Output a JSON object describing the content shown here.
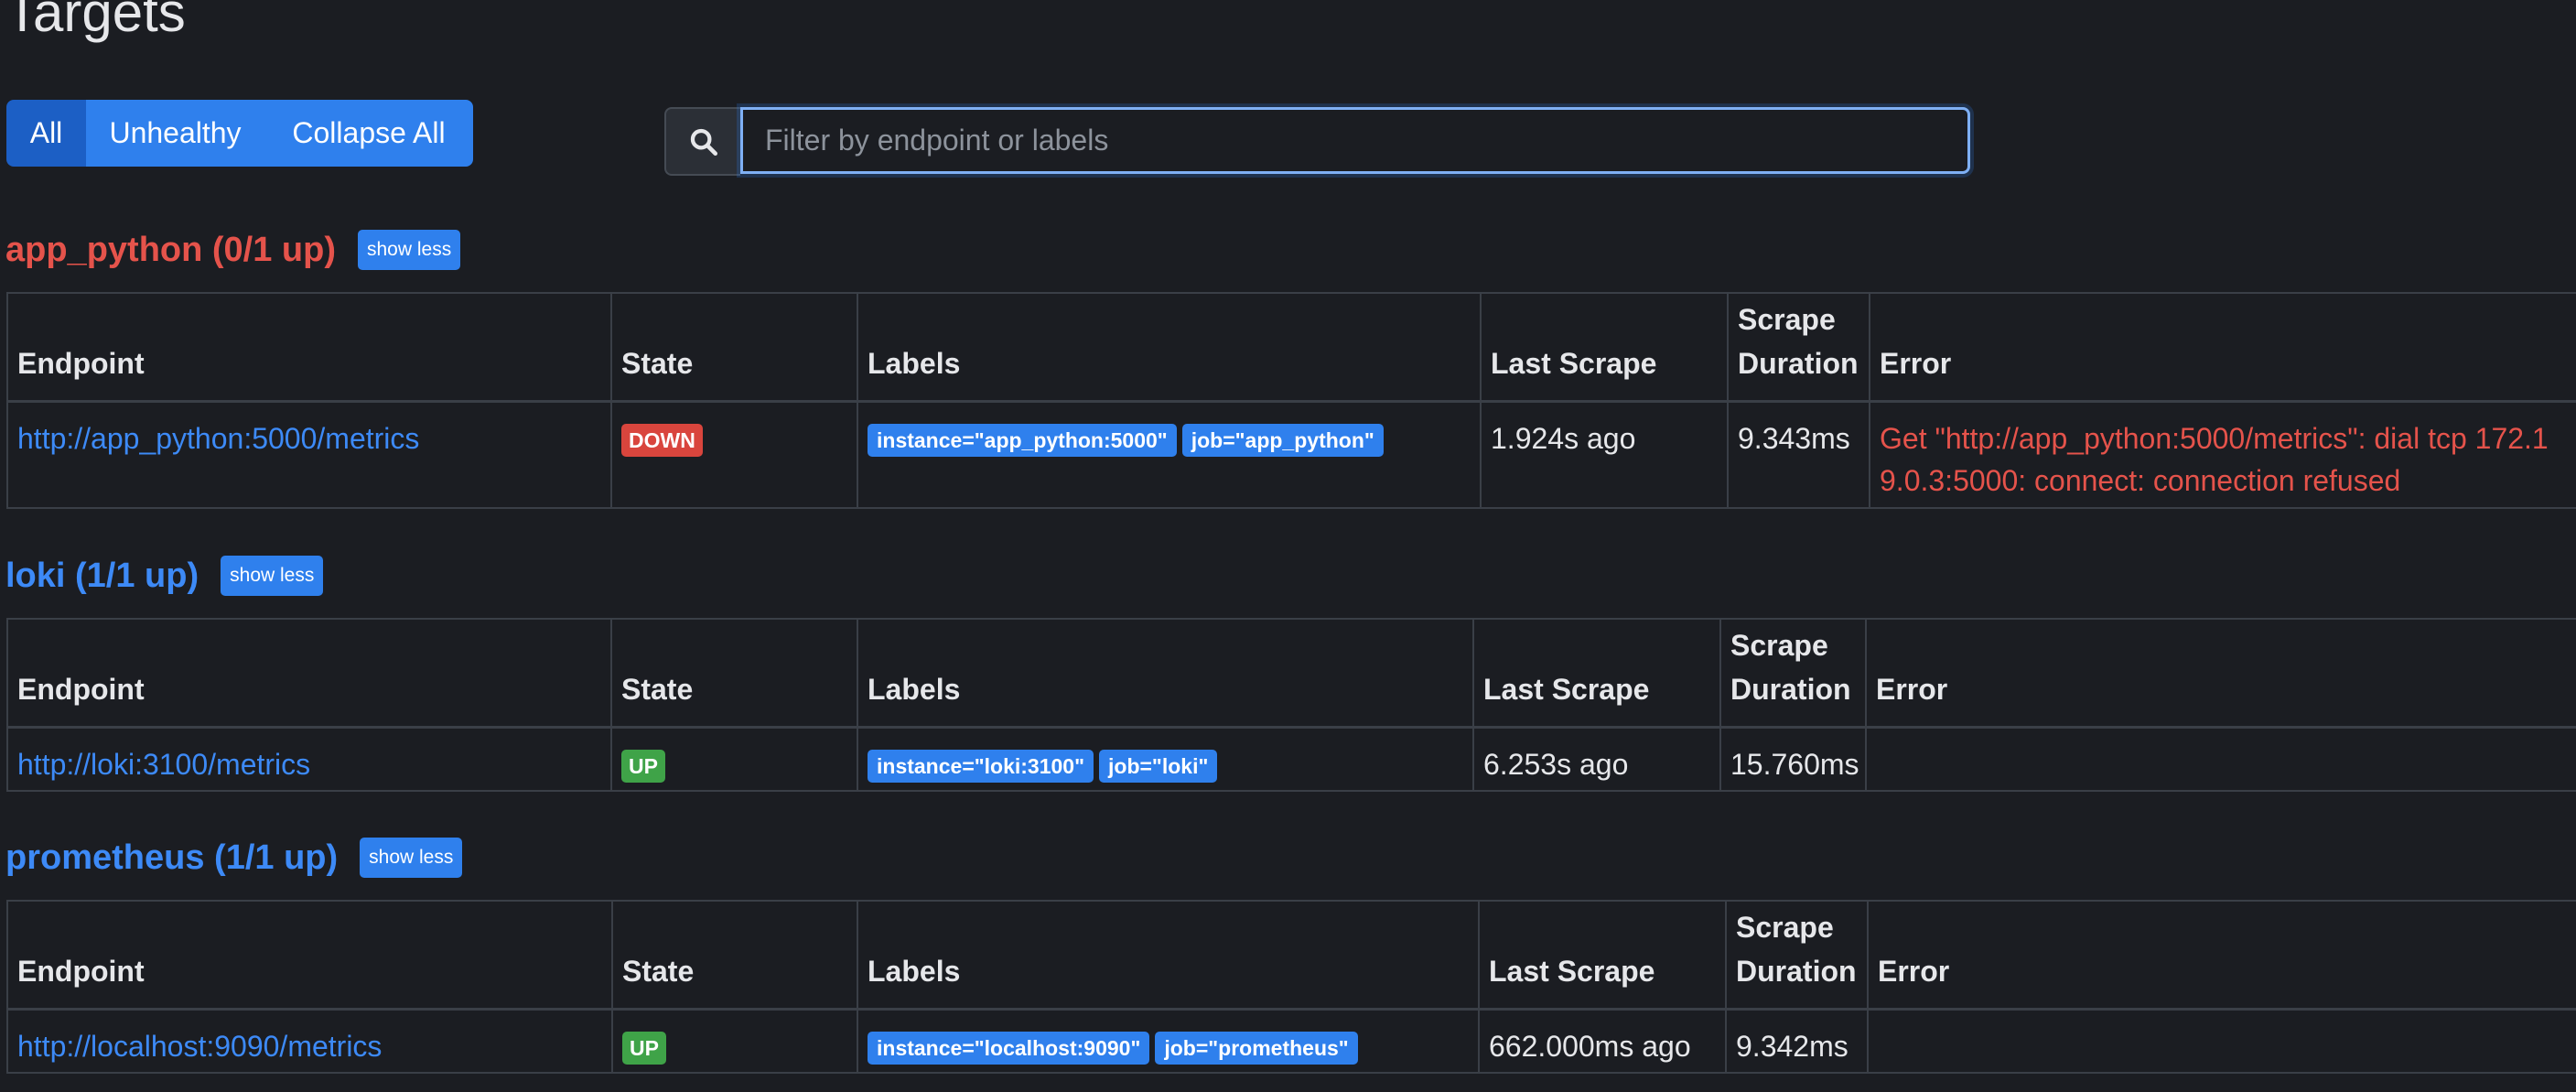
{
  "page": {
    "title": "Targets"
  },
  "filters": {
    "all": "All",
    "unhealthy": "Unhealthy",
    "collapse_all": "Collapse All"
  },
  "search": {
    "placeholder": "Filter by endpoint or labels",
    "icon": "search-icon"
  },
  "columns": {
    "endpoint": "Endpoint",
    "state": "State",
    "labels": "Labels",
    "last_scrape": "Last Scrape",
    "scrape_duration_1": "Scrape",
    "scrape_duration_2": "Duration",
    "error": "Error"
  },
  "jobs": [
    {
      "title": "app_python (0/1 up)",
      "toggle": "show less",
      "title_color": "#e5534b",
      "rows": [
        {
          "endpoint": "http://app_python:5000/metrics",
          "state": "DOWN",
          "labels": [
            "instance=\"app_python:5000\"",
            "job=\"app_python\""
          ],
          "last_scrape": "1.924s ago",
          "scrape_duration": "9.343ms",
          "error_line1": "Get \"http://app_python:5000/metrics\": dial tcp 172.1",
          "error_line2": "9.0.3:5000: connect: connection refused"
        }
      ]
    },
    {
      "title": "loki (1/1 up)",
      "toggle": "show less",
      "title_color": "#3d8af7",
      "rows": [
        {
          "endpoint": "http://loki:3100/metrics",
          "state": "UP",
          "labels": [
            "instance=\"loki:3100\"",
            "job=\"loki\""
          ],
          "last_scrape": "6.253s ago",
          "scrape_duration": "15.760ms",
          "error_line1": "",
          "error_line2": ""
        }
      ]
    },
    {
      "title": "prometheus (1/1 up)",
      "toggle": "show less",
      "title_color": "#3d8af7",
      "rows": [
        {
          "endpoint": "http://localhost:9090/metrics",
          "state": "UP",
          "labels": [
            "instance=\"localhost:9090\"",
            "job=\"prometheus\""
          ],
          "last_scrape": "662.000ms ago",
          "scrape_duration": "9.342ms",
          "error_line1": "",
          "error_line2": ""
        }
      ]
    }
  ],
  "colors": {
    "accent": "#2f80ed",
    "down": "#d9453d",
    "up": "#3fa348",
    "background": "#1b1d22"
  }
}
